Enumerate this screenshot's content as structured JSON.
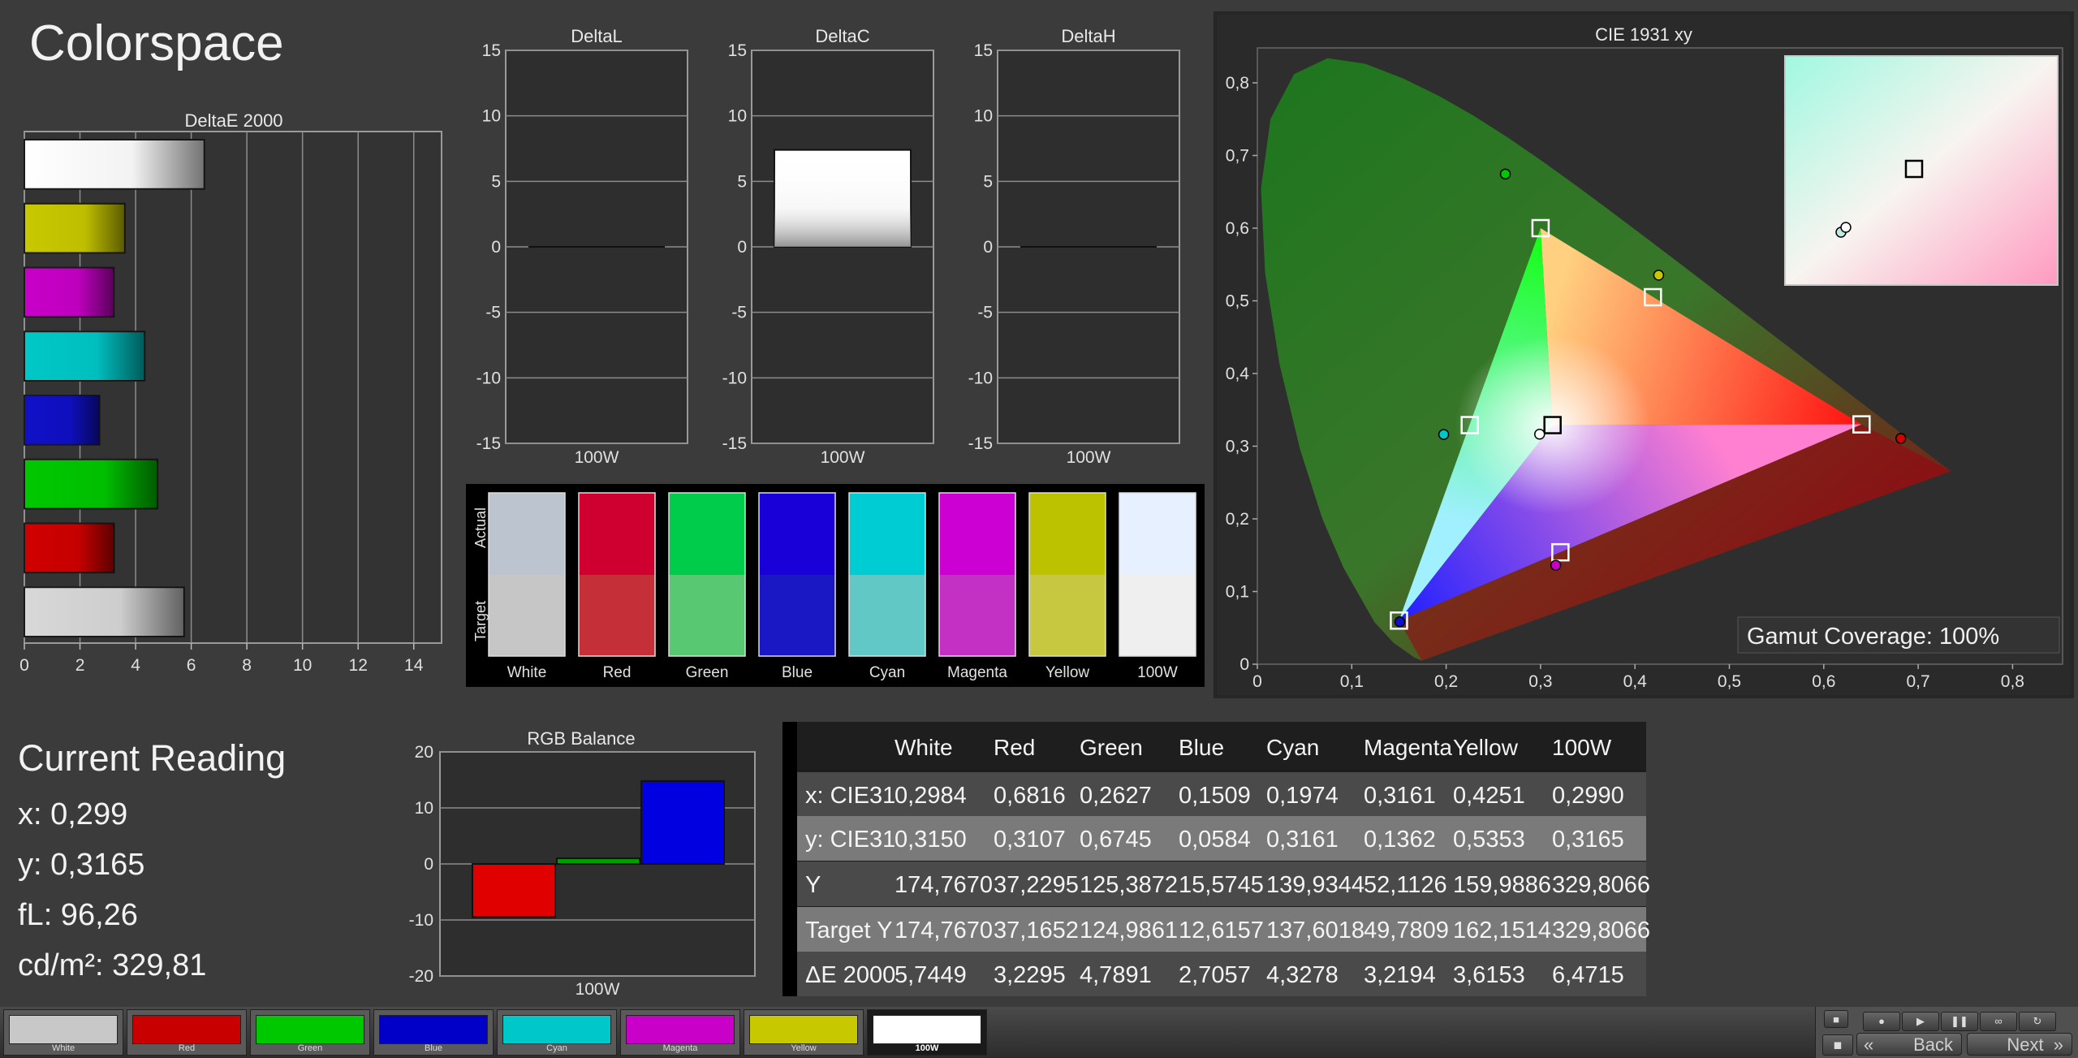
{
  "app": {
    "title": "Colorspace"
  },
  "colors": {
    "White": "#d8d8d8",
    "Red": "#d00000",
    "Green": "#00c800",
    "Blue": "#1010c8",
    "Cyan": "#00c8c8",
    "Magenta": "#c800c8",
    "Yellow": "#c8c800",
    "100W": "#ffffff"
  },
  "chart_data": [
    {
      "id": "deltae",
      "type": "bar",
      "orientation": "horizontal",
      "title": "DeltaE 2000",
      "categories": [
        "100W",
        "Yellow",
        "Magenta",
        "Cyan",
        "Blue",
        "Green",
        "Red",
        "White"
      ],
      "values": [
        6.4715,
        3.6153,
        3.2194,
        4.3278,
        2.7057,
        4.7891,
        3.2295,
        5.7449
      ],
      "xlim": [
        0,
        15
      ],
      "xticks": [
        "0",
        "2",
        "4",
        "6",
        "8",
        "10",
        "12",
        "14"
      ]
    },
    {
      "id": "deltal",
      "type": "bar",
      "title": "DeltaL",
      "categories": [
        "100W"
      ],
      "values": [
        0
      ],
      "ylim": [
        -15,
        15
      ],
      "yticks": [
        "15",
        "10",
        "5",
        "0",
        "-5",
        "-10",
        "-15"
      ]
    },
    {
      "id": "deltac",
      "type": "bar",
      "title": "DeltaC",
      "categories": [
        "100W"
      ],
      "values": [
        7.4
      ],
      "ylim": [
        -15,
        15
      ],
      "yticks": [
        "15",
        "10",
        "5",
        "0",
        "-5",
        "-10",
        "-15"
      ]
    },
    {
      "id": "deltah",
      "type": "bar",
      "title": "DeltaH",
      "categories": [
        "100W"
      ],
      "values": [
        0
      ],
      "ylim": [
        -15,
        15
      ],
      "yticks": [
        "15",
        "10",
        "5",
        "0",
        "-5",
        "-10",
        "-15"
      ]
    },
    {
      "id": "rgb_balance",
      "type": "bar",
      "title": "RGB Balance",
      "xlabel": "100W",
      "series": [
        {
          "color": "#e00000",
          "value": -9.5
        },
        {
          "color": "#00a000",
          "value": 1.0
        },
        {
          "color": "#0000e0",
          "value": 14.8
        }
      ],
      "ylim": [
        -20,
        20
      ],
      "yticks": [
        "20",
        "10",
        "0",
        "-10",
        "-20"
      ]
    },
    {
      "id": "cie",
      "type": "scatter",
      "title": "CIE 1931 xy",
      "xlim": [
        0,
        0.85
      ],
      "ylim": [
        0,
        0.85
      ],
      "xticks": [
        "0",
        "0,1",
        "0,2",
        "0,3",
        "0,4",
        "0,5",
        "0,6",
        "0,7",
        "0,8"
      ],
      "yticks": [
        "0",
        "0,1",
        "0,2",
        "0,3",
        "0,4",
        "0,5",
        "0,6",
        "0,7",
        "0,8"
      ],
      "target_points": [
        {
          "x": 0.64,
          "y": 0.33
        },
        {
          "x": 0.3,
          "y": 0.6
        },
        {
          "x": 0.15,
          "y": 0.06
        },
        {
          "x": 0.225,
          "y": 0.329
        },
        {
          "x": 0.321,
          "y": 0.154
        },
        {
          "x": 0.419,
          "y": 0.505
        },
        {
          "x": 0.3127,
          "y": 0.329
        }
      ],
      "measured_points": [
        {
          "x": 0.6816,
          "y": 0.3107,
          "color": "#d00000"
        },
        {
          "x": 0.2627,
          "y": 0.6745,
          "color": "#00c800"
        },
        {
          "x": 0.1509,
          "y": 0.0584,
          "color": "#1010c8"
        },
        {
          "x": 0.1974,
          "y": 0.3161,
          "color": "#00c8c8"
        },
        {
          "x": 0.3161,
          "y": 0.1362,
          "color": "#c800c8"
        },
        {
          "x": 0.4251,
          "y": 0.5353,
          "color": "#c8c800"
        },
        {
          "x": 0.299,
          "y": 0.3165,
          "color": "#ffffff"
        }
      ],
      "annotation": "Gamut Coverage:  100%"
    },
    {
      "id": "readings_table",
      "type": "table",
      "columns": [
        "",
        "White",
        "Red",
        "Green",
        "Blue",
        "Cyan",
        "Magenta",
        "Yellow",
        "100W"
      ],
      "rows": [
        [
          "x: CIE31",
          "0,2984",
          "0,6816",
          "0,2627",
          "0,1509",
          "0,1974",
          "0,3161",
          "0,4251",
          "0,2990"
        ],
        [
          "y: CIE31",
          "0,3150",
          "0,3107",
          "0,6745",
          "0,0584",
          "0,3161",
          "0,1362",
          "0,5353",
          "0,3165"
        ],
        [
          "Y",
          "174,7670",
          "37,2295",
          "125,3872",
          "15,5745",
          "139,9344",
          "52,1126",
          "159,9886",
          "329,8066"
        ],
        [
          "Target Y",
          "174,7670",
          "37,1652",
          "124,9861",
          "12,6157",
          "137,6018",
          "49,7809",
          "162,1514",
          "329,8066"
        ],
        [
          "ΔE 2000",
          "5,7449",
          "3,2295",
          "4,7891",
          "2,7057",
          "4,3278",
          "3,2194",
          "3,6153",
          "6,4715"
        ]
      ]
    }
  ],
  "swatches": {
    "side_actual": "Actual",
    "side_target": "Target",
    "items": [
      {
        "label": "White",
        "actual": "#bcc4cf",
        "target": "#c6c6c6"
      },
      {
        "label": "Red",
        "actual": "#cf0030",
        "target": "#c53038"
      },
      {
        "label": "Green",
        "actual": "#00cc4c",
        "target": "#58c872"
      },
      {
        "label": "Blue",
        "actual": "#1a00d8",
        "target": "#1a18c4"
      },
      {
        "label": "Cyan",
        "actual": "#00ccd4",
        "target": "#62c8c6"
      },
      {
        "label": "Magenta",
        "actual": "#cc00d2",
        "target": "#c230c4"
      },
      {
        "label": "Yellow",
        "actual": "#bcc200",
        "target": "#c8c840"
      },
      {
        "label": "100W",
        "actual": "#e6f0ff",
        "target": "#efefef"
      }
    ]
  },
  "current_reading": {
    "title": "Current Reading",
    "x": "x: 0,299",
    "y": "y: 0,3165",
    "fl": "fL: 96,26",
    "cd": "cd/m²: 329,81"
  },
  "taskbar": {
    "items": [
      {
        "label": "White",
        "color": "#c8c8c8"
      },
      {
        "label": "Red",
        "color": "#c80000"
      },
      {
        "label": "Green",
        "color": "#00c800"
      },
      {
        "label": "Blue",
        "color": "#0000c8"
      },
      {
        "label": "Cyan",
        "color": "#00c8c8"
      },
      {
        "label": "Magenta",
        "color": "#c800c8"
      },
      {
        "label": "Yellow",
        "color": "#c8c800"
      },
      {
        "label": "100W",
        "color": "#ffffff"
      }
    ],
    "active": "100W"
  },
  "nav": {
    "back": "Back",
    "next": "Next"
  }
}
